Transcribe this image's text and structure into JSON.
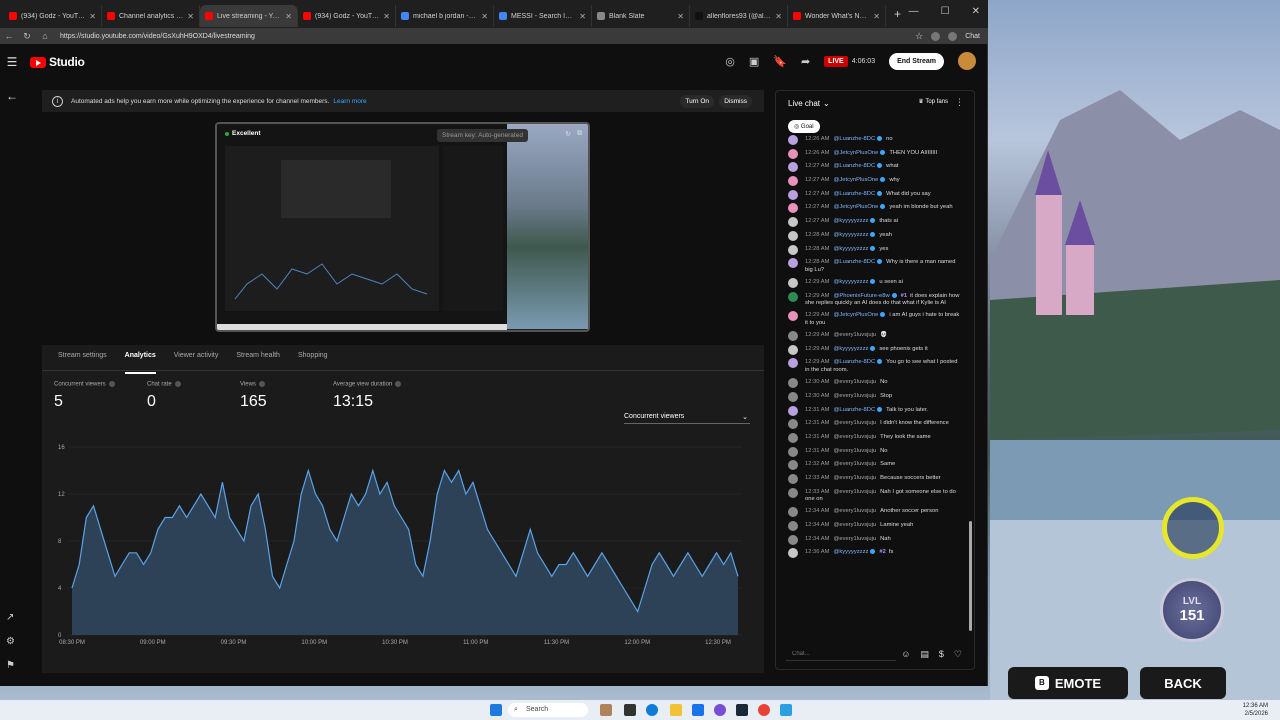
{
  "browser": {
    "tabs": [
      {
        "title": "(934) Godz - YouTube",
        "color": "#ff0000",
        "active": false
      },
      {
        "title": "Channel analytics - YouT",
        "color": "#ff0000",
        "active": false
      },
      {
        "title": "Live streaming - YouTube",
        "color": "#ff0000",
        "active": true
      },
      {
        "title": "(934) Godz - YouTube",
        "color": "#ff0000",
        "active": false
      },
      {
        "title": "michael b jordan - Searc",
        "color": "#4285f4",
        "active": false
      },
      {
        "title": "MESSI - Search Images",
        "color": "#4285f4",
        "active": false
      },
      {
        "title": "Blank Slate",
        "color": "#888888",
        "active": false
      },
      {
        "title": "allenflores93 (@allenflo",
        "color": "#111111",
        "active": false
      },
      {
        "title": "Wonder What's Next (Ep",
        "color": "#ff0000",
        "active": false
      }
    ],
    "url": "https://studio.youtube.com/video/GsXuhH9OXD4/livestreaming",
    "chat_button": "Chat"
  },
  "header": {
    "studio_label": "Studio",
    "live_badge": "LIVE",
    "live_time": "4:06:03",
    "end_stream": "End Stream"
  },
  "banner": {
    "text": "Automated ads help you earn more while optimizing the experience for channel members.",
    "learn_more": "Learn more",
    "turn_on": "Turn On",
    "dismiss": "Dismiss"
  },
  "preview": {
    "status": "Excellent",
    "stream_key": "Stream key: Auto-generated"
  },
  "analytics": {
    "tabs": [
      "Stream settings",
      "Analytics",
      "Viewer activity",
      "Stream health",
      "Shopping"
    ],
    "selected_tab": 1,
    "metrics": [
      {
        "label": "Concurrent viewers",
        "value": "5"
      },
      {
        "label": "Chat rate",
        "value": "0"
      },
      {
        "label": "Views",
        "value": "165"
      },
      {
        "label": "Average view duration",
        "value": "13:15"
      }
    ],
    "dropdown": "Concurrent viewers"
  },
  "chart_data": {
    "type": "area",
    "ylim": [
      0,
      16
    ],
    "yticks": [
      "0",
      "4",
      "8",
      "12",
      "16"
    ],
    "xticks": [
      "08:30 PM",
      "09:00 PM",
      "09:30 PM",
      "10:00 PM",
      "10:30 PM",
      "11:00 PM",
      "11:30 PM",
      "12:00 PM",
      "12:30 PM"
    ],
    "x_start_minutes": 0,
    "x_end_minutes": 245,
    "series": [
      {
        "values": [
          4,
          6,
          10,
          11,
          9,
          7,
          5,
          6,
          7,
          7,
          6,
          7,
          9,
          10,
          10,
          11,
          10,
          11,
          12,
          11,
          10,
          13,
          10,
          9,
          8,
          11,
          12,
          9,
          5,
          4,
          6,
          8,
          12,
          14,
          12,
          11,
          9,
          8,
          10,
          12,
          11,
          12,
          14,
          12,
          13,
          11,
          10,
          9,
          6,
          5,
          8,
          12,
          14,
          13,
          14,
          12,
          13,
          11,
          9,
          8,
          7,
          6,
          5,
          7,
          9,
          7,
          6,
          5,
          6,
          6,
          7,
          6,
          5,
          6,
          7,
          6,
          5,
          4,
          3,
          2,
          4,
          6,
          7,
          6,
          5,
          6,
          7,
          6,
          5,
          6,
          7,
          6,
          7,
          5
        ]
      }
    ],
    "color": "#5aa3e8",
    "fill": "#2e4257"
  },
  "chat": {
    "title": "Live chat",
    "top_fans": "Top fans",
    "goal": "Goal",
    "input_placeholder": "Chat...",
    "messages": [
      {
        "time": "12:26 AM",
        "name": "@Luanzhe-8DC",
        "text": "no",
        "color": "#b9a0e0",
        "verified": true
      },
      {
        "time": "12:26 AM",
        "name": "@JetcynPlusOne",
        "text": "THEN YOU AIIIIIIII",
        "color": "#e891b9",
        "verified": true
      },
      {
        "time": "12:27 AM",
        "name": "@Luanzhe-8DC",
        "text": "what",
        "color": "#b9a0e0",
        "verified": true
      },
      {
        "time": "12:27 AM",
        "name": "@JetcynPlusOne",
        "text": "why",
        "color": "#e891b9",
        "verified": true
      },
      {
        "time": "12:27 AM",
        "name": "@Luanzhe-8DC",
        "text": "What did you say",
        "color": "#b9a0e0",
        "verified": true
      },
      {
        "time": "12:27 AM",
        "name": "@JetcynPlusOne",
        "text": "yeah im blonde but yeah",
        "color": "#e891b9",
        "verified": true
      },
      {
        "time": "12:27 AM",
        "name": "@kyyyyyzzzz",
        "text": "thats ai",
        "color": "#c7c7c7",
        "verified": true
      },
      {
        "time": "12:28 AM",
        "name": "@kyyyyyzzzz",
        "text": "yeah",
        "color": "#c7c7c7",
        "verified": true
      },
      {
        "time": "12:28 AM",
        "name": "@kyyyyyzzzz",
        "text": "yes",
        "color": "#c7c7c7",
        "verified": true
      },
      {
        "time": "12:28 AM",
        "name": "@Luanzhe-8DC",
        "text": "Why is there a man named big Lu?",
        "color": "#b9a0e0",
        "verified": true
      },
      {
        "time": "12:29 AM",
        "name": "@kyyyyyzzzz",
        "text": "u seen ai",
        "color": "#c7c7c7",
        "verified": true
      },
      {
        "time": "12:29 AM",
        "name": "@PhoenixFuture-e8w",
        "badge": "#1",
        "text": "it does explain how she replies quickly an AI does do that what if Kylie is AI",
        "color": "#2e8b57",
        "verified": true
      },
      {
        "time": "12:29 AM",
        "name": "@JetcynPlusOne",
        "text": "i am AI guys i hate to break it to you",
        "color": "#e891b9",
        "verified": true
      },
      {
        "time": "12:29 AM",
        "name": "@every1luvsjuju",
        "text": "💀",
        "color": "#888888",
        "plain": true
      },
      {
        "time": "12:29 AM",
        "name": "@kyyyyyzzzz",
        "text": "see phoenix gets it",
        "color": "#c7c7c7",
        "verified": true
      },
      {
        "time": "12:29 AM",
        "name": "@Luanzhe-8DC",
        "text": "You go to see what I posted in the chat room.",
        "color": "#b9a0e0",
        "verified": true
      },
      {
        "time": "12:30 AM",
        "name": "@every1luvsjuju",
        "text": "No",
        "color": "#888888",
        "plain": true
      },
      {
        "time": "12:30 AM",
        "name": "@every1luvsjuju",
        "text": "Stop",
        "color": "#888888",
        "plain": true
      },
      {
        "time": "12:31 AM",
        "name": "@Luanzhe-8DC",
        "text": "Talk to you later.",
        "color": "#b9a0e0",
        "verified": true
      },
      {
        "time": "12:31 AM",
        "name": "@every1luvsjuju",
        "text": "I didn't know the difference",
        "color": "#888888",
        "plain": true
      },
      {
        "time": "12:31 AM",
        "name": "@every1luvsjuju",
        "text": "They look the same",
        "color": "#888888",
        "plain": true
      },
      {
        "time": "12:31 AM",
        "name": "@every1luvsjuju",
        "text": "No",
        "color": "#888888",
        "plain": true
      },
      {
        "time": "12:32 AM",
        "name": "@every1luvsjuju",
        "text": "Same",
        "color": "#888888",
        "plain": true
      },
      {
        "time": "12:33 AM",
        "name": "@every1luvsjuju",
        "text": "Because soccers better",
        "color": "#888888",
        "plain": true
      },
      {
        "time": "12:33 AM",
        "name": "@every1luvsjuju",
        "text": "Nah I got someone else to do one on",
        "color": "#888888",
        "plain": true
      },
      {
        "time": "12:34 AM",
        "name": "@every1luvsjuju",
        "text": "Another soccer person",
        "color": "#888888",
        "plain": true
      },
      {
        "time": "12:34 AM",
        "name": "@every1luvsjuju",
        "text": "Lamine yeah",
        "color": "#888888",
        "plain": true
      },
      {
        "time": "12:34 AM",
        "name": "@every1luvsjuju",
        "text": "Nah",
        "color": "#888888",
        "plain": true
      },
      {
        "time": "12:36 AM",
        "name": "@kyyyyyzzzz",
        "badge": "#2",
        "text": "fs",
        "color": "#c7c7c7",
        "verified": true
      }
    ]
  },
  "game": {
    "emote_key": "B",
    "emote": "EMOTE",
    "back": "BACK",
    "lvl_label": "LVL",
    "lvl_value": "151"
  },
  "taskbar": {
    "search": "Search",
    "time": "12:36 AM",
    "date": "2/5/2026"
  }
}
